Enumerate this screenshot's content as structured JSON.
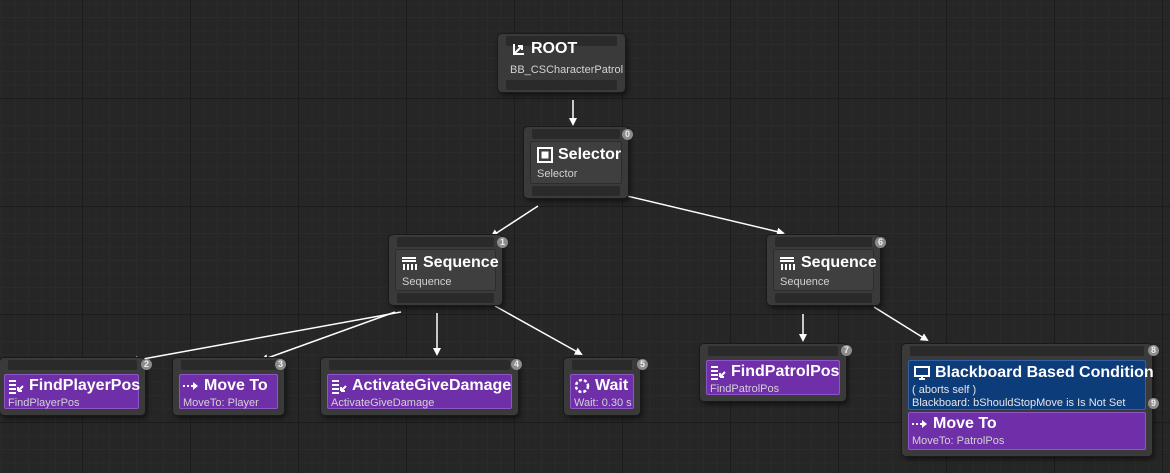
{
  "root": {
    "title": "ROOT",
    "subtitle": "BB_CSCharacterPatrol"
  },
  "selector": {
    "title": "Selector",
    "subtitle": "Selector",
    "index": "0"
  },
  "sequence_left": {
    "title": "Sequence",
    "subtitle": "Sequence",
    "index": "1"
  },
  "sequence_right": {
    "title": "Sequence",
    "subtitle": "Sequence",
    "index": "6"
  },
  "tasks": {
    "find_player_pos": {
      "title": "FindPlayerPos",
      "subtitle": "FindPlayerPos",
      "index": "2"
    },
    "move_to_player": {
      "title": "Move To",
      "subtitle": "MoveTo: Player",
      "index": "3"
    },
    "activate_give_damage": {
      "title": "ActivateGiveDamage",
      "subtitle": "ActivateGiveDamage",
      "index": "4"
    },
    "wait": {
      "title": "Wait",
      "subtitle": "Wait: 0.30 s",
      "index": "5"
    },
    "find_patrol_pos": {
      "title": "FindPatrolPos",
      "subtitle": "FindPatrolPos",
      "index": "7"
    },
    "move_to_patrol": {
      "title": "Move To",
      "subtitle": "MoveTo: PatrolPos",
      "index": "9"
    }
  },
  "decorator": {
    "title": "Blackboard Based Condition",
    "line1": "( aborts self )",
    "line2": "Blackboard: bShouldStopMove is Is Not Set",
    "index": "8"
  },
  "colors": {
    "task": "#6f2fa8",
    "decorator": "#0d3c7a",
    "composite": "#3a3a3a",
    "wire": "#ffffff"
  },
  "icons": {
    "root": "root-arrow-icon",
    "selector": "selector-icon",
    "sequence": "sequence-icon",
    "task": "task-list-icon",
    "move_to": "move-arrow-icon",
    "wait": "wait-dotted-circle-icon",
    "decorator": "monitor-icon"
  }
}
